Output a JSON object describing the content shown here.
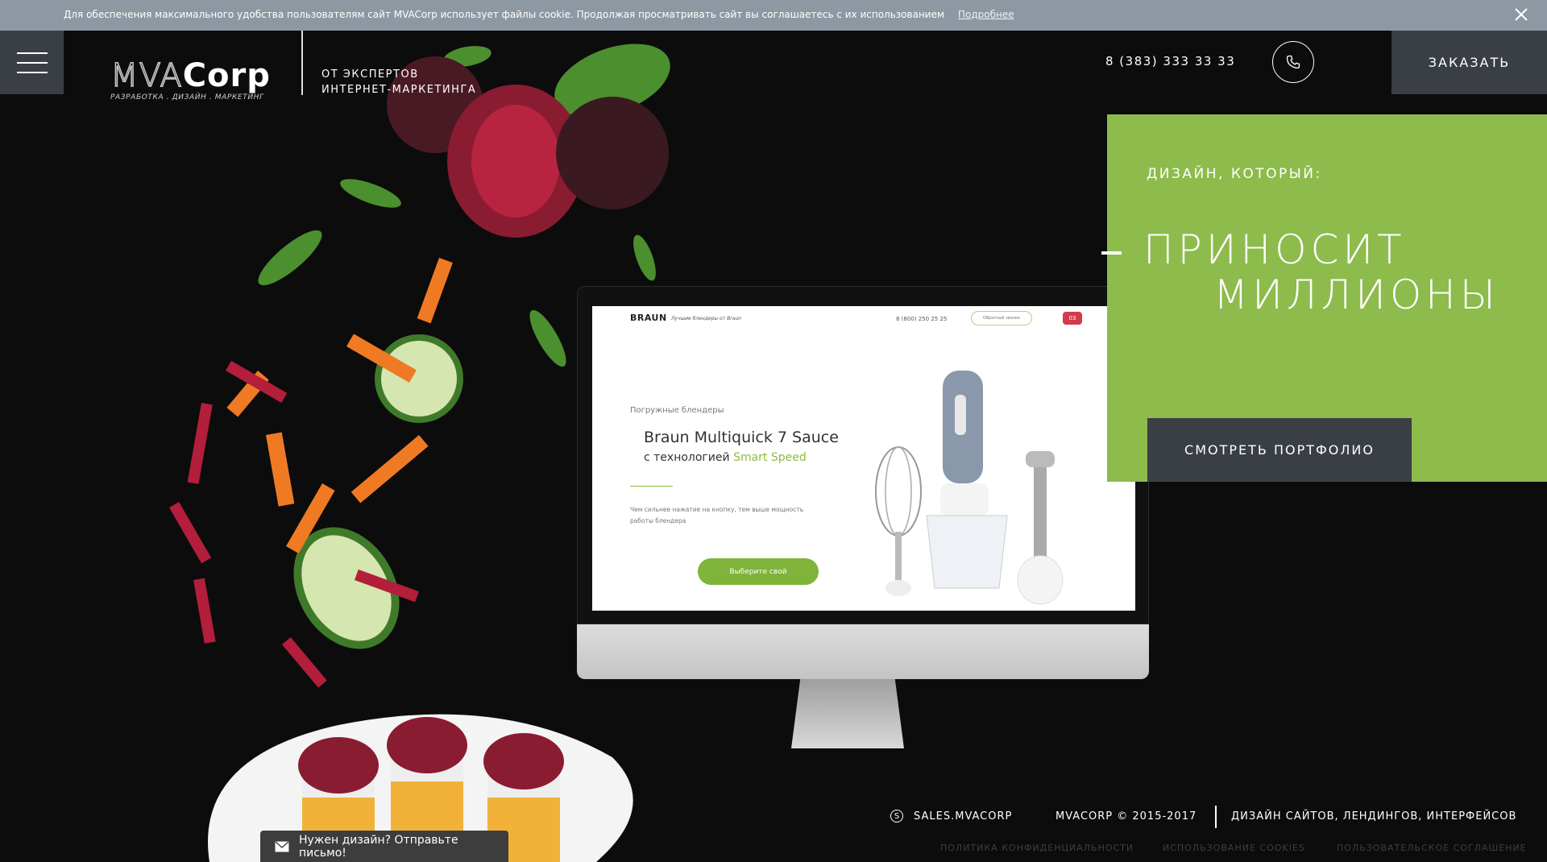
{
  "cookie": {
    "text": "Для обеспечения максимального удобства пользователям сайт MVACorp использует файлы cookie. Продолжая просматривать сайт вы соглашаетесь с их использованием",
    "more": "Подробнее"
  },
  "header": {
    "logo_mva": "MVA",
    "logo_corp": "Corp",
    "logo_sub": "РАЗРАБОТКА . ДИЗАЙН . МАРКЕТИНГ",
    "tagline_line1": "ОТ ЭКСПЕРТОВ",
    "tagline_line2": "ИНТЕРНЕТ-МАРКЕТИНГА",
    "phone": "8 (383) 333 33 33",
    "order_label": "ЗАКАЗАТЬ"
  },
  "promo": {
    "subtitle": "ДИЗАЙН, КОТОРЫЙ:",
    "headline_line1": "ПРИНОСИТ",
    "headline_line2": "МИЛЛИОНЫ",
    "portfolio_label": "СМОТРЕТЬ ПОРТФОЛИО"
  },
  "mini_site": {
    "brand": "BRAUN",
    "tagline": "Лучшие блендеры от Braun",
    "phone": "8 (800) 250 25 25",
    "call_label": "Обратный звонок",
    "badge": "03",
    "category": "Погружные блендеры",
    "title": "Braun Multiquick 7 Sauce",
    "subtitle_prefix": "с технологией",
    "subtitle_highlight": "Smart Speed",
    "description": "Чем сильнее нажатие на кнопку, тем выше мощность работы блендера",
    "button": "Выберите свой"
  },
  "footer": {
    "skype": "SALES.MVACORP",
    "copyright": "MVACORP © 2015-2017",
    "description": "ДИЗАЙН САЙТОВ, ЛЕНДИНГОВ, ИНТЕРФЕЙСОВ",
    "links": [
      "ПОЛИТИКА КОНФИДЕНЦИАЛЬНОСТИ",
      "ИСПОЛЬЗОВАНИЕ COOKIES",
      "ПОЛЬЗОВАТЕЛЬСКОЕ СОГЛАШЕНИЕ"
    ]
  },
  "mail_prompt": "Нужен дизайн? Отправьте письмо!",
  "colors": {
    "background": "#0c0c0c",
    "accent_green": "#8dbb4c",
    "dark_button": "#3a3f46",
    "cookie_bar": "#8e98a3"
  },
  "icons": [
    "menu-icon",
    "close-icon",
    "phone-icon",
    "skype-icon",
    "mail-icon"
  ]
}
